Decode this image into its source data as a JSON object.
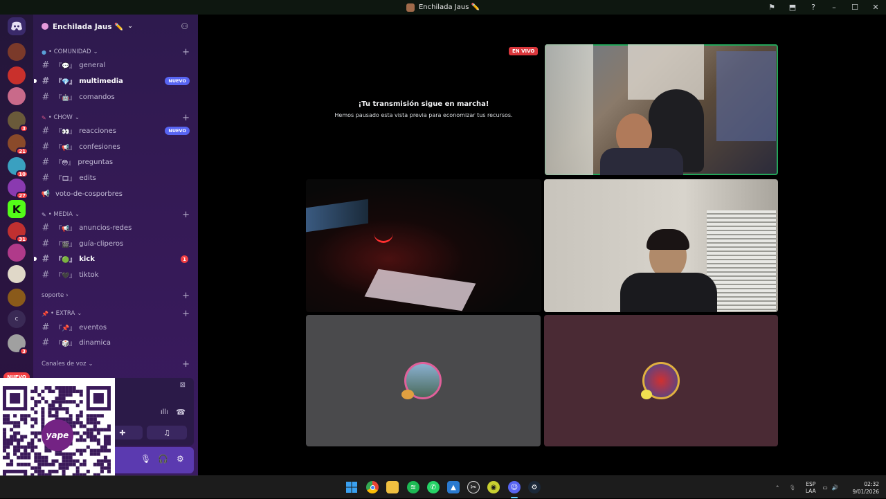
{
  "window": {
    "title": "Enchilada Jaus ✏️",
    "controls": {
      "minimize": "–",
      "maximize": "☐",
      "close": "✕"
    }
  },
  "rail": {
    "servers": [
      {
        "name": "server-1",
        "color": "#7b3a2a"
      },
      {
        "name": "server-2",
        "color": "#c9302c"
      },
      {
        "name": "server-3",
        "color": "#c96a8a"
      },
      {
        "name": "server-4",
        "color": "#6a5a3a",
        "badge": "3"
      },
      {
        "name": "server-5",
        "color": "#8a4a2a",
        "badge": "21"
      },
      {
        "name": "server-6",
        "color": "#3aa0c0",
        "badge": "10"
      },
      {
        "name": "server-7",
        "color": "#8a3ab0",
        "badge": "27"
      },
      {
        "name": "server-8",
        "color": "#53fc18",
        "letter": "K"
      },
      {
        "name": "server-9",
        "color": "#c03030",
        "badge": "31"
      },
      {
        "name": "server-10",
        "color": "#b03a8a"
      },
      {
        "name": "server-11",
        "color": "#e0d8c8"
      },
      {
        "name": "server-12",
        "color": "#8a5a1a"
      },
      {
        "name": "server-13",
        "color": "#3a2a55",
        "letter": "c"
      },
      {
        "name": "server-14",
        "color": "#a0a0a0",
        "badge": "3"
      }
    ],
    "new_label": "NUEVO"
  },
  "sidebar": {
    "guild_name": "Enchilada Jaus ✏️",
    "categories": [
      {
        "label": "• COMUNIDAD",
        "channels": [
          {
            "emoji": "『💬』",
            "name": "general"
          },
          {
            "emoji": "『💎』",
            "name": "multimedia",
            "bold": true,
            "badge": "NUEVO"
          },
          {
            "emoji": "『🤖』",
            "name": "comandos"
          }
        ]
      },
      {
        "label": "• CHOW",
        "channels": [
          {
            "emoji": "『👀』",
            "name": "reacciones",
            "badge": "NUEVO"
          },
          {
            "emoji": "『📢』",
            "name": "confesiones"
          },
          {
            "emoji": "『😳』",
            "name": "preguntas"
          },
          {
            "emoji": "『🎞』",
            "name": "edits"
          },
          {
            "emoji": "",
            "name": "voto-de-cosporbres",
            "icon": "megaphone"
          }
        ]
      },
      {
        "label": "• MEDIA",
        "channels": [
          {
            "emoji": "『📢』",
            "name": "anuncios-redes"
          },
          {
            "emoji": "『🎬』",
            "name": "guía-cliperos"
          },
          {
            "emoji": "『🟢』",
            "name": "kick",
            "bold": true,
            "count": "1"
          },
          {
            "emoji": "『🖤』",
            "name": "tiktok"
          }
        ]
      },
      {
        "label": "soporte",
        "channels": []
      },
      {
        "label": "• EXTRA",
        "channels": [
          {
            "emoji": "『📌』",
            "name": "eventos"
          },
          {
            "emoji": "『🎲』",
            "name": "dinamica"
          }
        ]
      },
      {
        "label": "Canales de voz",
        "channels": []
      }
    ]
  },
  "stage": {
    "live_label": "EN VIVO",
    "paused_title": "¡Tu transmisión sigue en marcha!",
    "paused_subtitle": "Hemos pausado esta vista previa para economizar tus recursos."
  },
  "taskbar": {
    "apps": [
      "windows-start",
      "chrome",
      "file-explorer",
      "spotify",
      "whatsapp",
      "photos",
      "capcut",
      "obs",
      "discord",
      "steam"
    ],
    "lang_top": "ESP",
    "lang_bottom": "LAA",
    "time": "02:32",
    "date": "9/01/2026"
  },
  "colors": {
    "sidebar": "#351a56",
    "accent": "#5865f2",
    "speaking": "#23a55a",
    "live": "#da373c"
  }
}
